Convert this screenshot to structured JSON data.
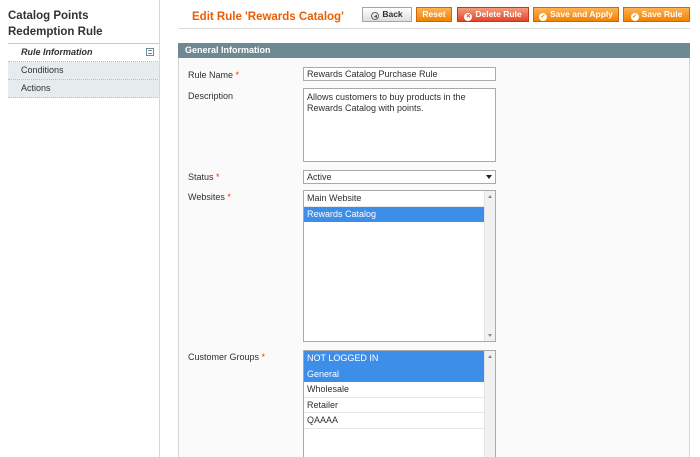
{
  "sidebar": {
    "title": "Catalog Points Redemption Rule",
    "tabs": [
      {
        "label": "Rule Information"
      },
      {
        "label": "Conditions"
      },
      {
        "label": "Actions"
      }
    ]
  },
  "header": {
    "title": "Edit Rule 'Rewards Catalog'",
    "buttons": {
      "back": "Back",
      "reset": "Reset",
      "delete": "Delete Rule",
      "save_apply": "Save and Apply",
      "save": "Save Rule"
    }
  },
  "panel": {
    "title": "General Information",
    "fields": {
      "rule_name": {
        "label": "Rule Name",
        "value": "Rewards Catalog Purchase Rule"
      },
      "description": {
        "label": "Description",
        "value": "Allows customers to buy products in the Rewards Catalog with points."
      },
      "status": {
        "label": "Status",
        "value": "Active"
      },
      "websites": {
        "label": "Websites",
        "options": [
          {
            "label": "Main Website",
            "selected": false
          },
          {
            "label": "Rewards Catalog",
            "selected": true
          }
        ]
      },
      "customer_groups": {
        "label": "Customer Groups",
        "options": [
          {
            "label": "NOT LOGGED IN",
            "selected": true
          },
          {
            "label": "General",
            "selected": true
          },
          {
            "label": "Wholesale",
            "selected": false
          },
          {
            "label": "Retailer",
            "selected": false
          },
          {
            "label": "QAAAA",
            "selected": false
          }
        ]
      }
    }
  },
  "colors": {
    "accent": "#eb5e00",
    "panel_header": "#6f8992",
    "selection": "#3d8ee8",
    "required": "#eb340a"
  }
}
